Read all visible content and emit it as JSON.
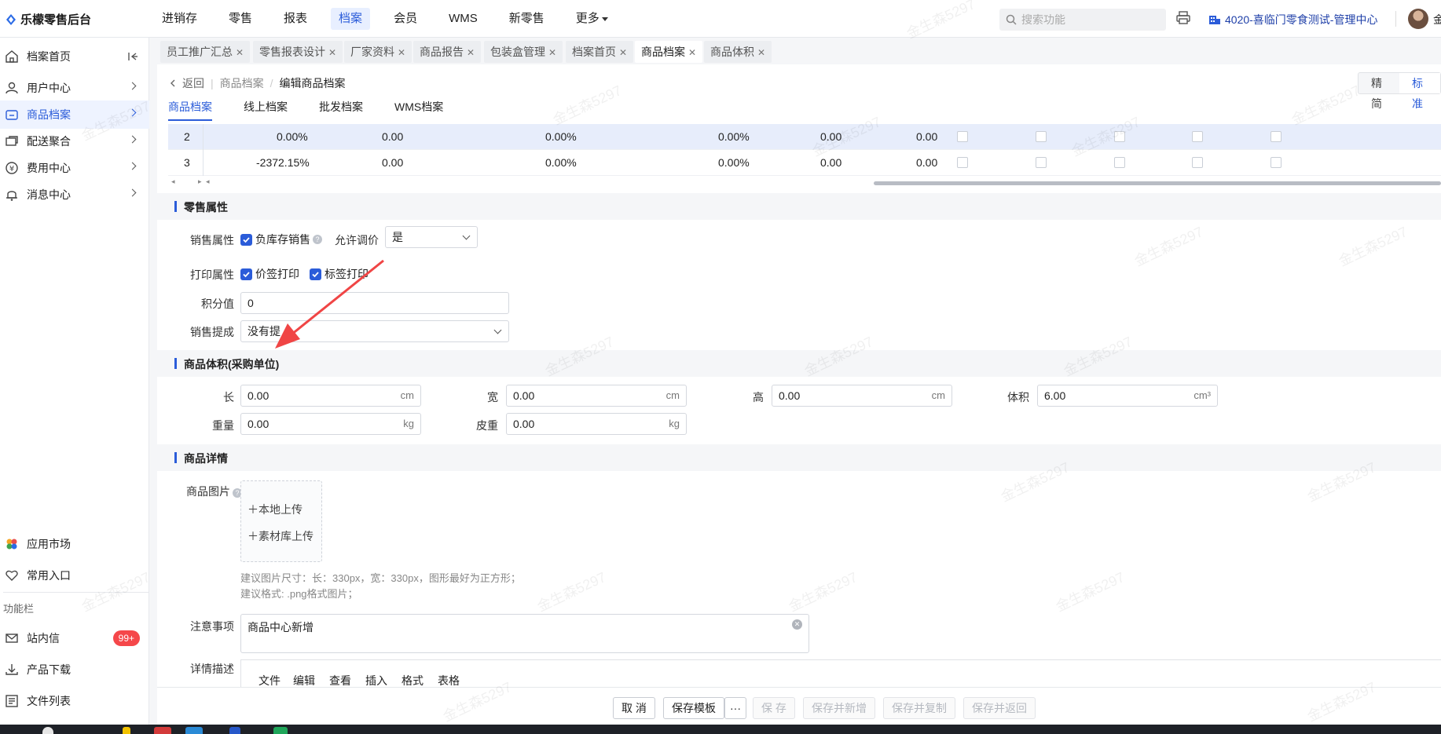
{
  "app": {
    "title": "乐檬零售后台"
  },
  "topnav": [
    "进销存",
    "零售",
    "报表",
    "档案",
    "会员",
    "WMS",
    "新零售",
    "更多"
  ],
  "search": {
    "placeholder": "搜索功能"
  },
  "store": {
    "name": "4020-喜临门零食测试-管理中心"
  },
  "user": {
    "name": "金"
  },
  "sidebar": {
    "items": [
      "档案首页",
      "用户中心",
      "商品档案",
      "配送聚合",
      "费用中心",
      "消息中心"
    ],
    "apps": [
      "应用市场",
      "常用入口"
    ],
    "section": "功能栏",
    "tools": [
      "站内信",
      "产品下载",
      "文件列表"
    ],
    "badge": "99+"
  },
  "tabs": [
    "员工推广汇总",
    "零售报表设计",
    "厂家资料",
    "商品报告",
    "包装盒管理",
    "档案首页",
    "商品档案",
    "商品体积"
  ],
  "breadcrumb": {
    "back": "返回",
    "parent": "商品档案",
    "current": "编辑商品档案"
  },
  "mode": {
    "simple": "精简",
    "standard": "标准"
  },
  "subtabs": [
    "商品档案",
    "线上档案",
    "批发档案",
    "WMS档案"
  ],
  "grid": {
    "rows": [
      {
        "no": "2",
        "c1": "0.00%",
        "c2": "0.00",
        "c3": "0.00%",
        "c4": "0.00%",
        "c5": "0.00",
        "c6": "0.00"
      },
      {
        "no": "3",
        "c1": "-2372.15%",
        "c2": "0.00",
        "c3": "0.00%",
        "c4": "0.00%",
        "c5": "0.00",
        "c6": "0.00"
      }
    ]
  },
  "retail": {
    "title": "零售属性",
    "sales_attr_label": "销售属性",
    "neg_stock": "负库存销售",
    "allow_price_label": "允许调价",
    "allow_price_value": "是",
    "print_label": "打印属性",
    "price_tag": "价签打印",
    "label_print": "标签打印",
    "points_label": "积分值",
    "points_value": "0",
    "commission_label": "销售提成",
    "commission_value": "没有提"
  },
  "volume": {
    "title": "商品体积(采购单位)",
    "length_label": "长",
    "length": "0.00",
    "width_label": "宽",
    "width": "0.00",
    "height_label": "高",
    "height": "0.00",
    "volume_label": "体积",
    "volume": "6.00",
    "weight_label": "重量",
    "weight": "0.00",
    "tare_label": "皮重",
    "tare": "0.00",
    "unit_cm": "cm",
    "unit_cm3": "cm³",
    "unit_kg": "kg"
  },
  "detail": {
    "title": "商品详情",
    "image_label": "商品图片",
    "local_upload": "本地上传",
    "library_upload": "素材库上传",
    "hint1": "建议图片尺寸：长：330px，宽：330px，图形最好为正方形；",
    "hint2": "建议格式: .png格式图片；",
    "notes_label": "注意事项",
    "notes_value": "商品中心新增",
    "desc_label": "详情描述",
    "editor_menu": [
      "文件",
      "编辑",
      "查看",
      "插入",
      "格式",
      "表格"
    ]
  },
  "footer": {
    "cancel": "取 消",
    "save_template": "保存模板",
    "more": "···",
    "save": "保 存",
    "save_new": "保存并新增",
    "save_copy": "保存并复制",
    "save_back": "保存并返回"
  },
  "watermark": "金生森5297",
  "colors": {
    "accent": "#2b5cd9",
    "badge": "#f5474a",
    "annotation_arrow": "#f04545"
  }
}
